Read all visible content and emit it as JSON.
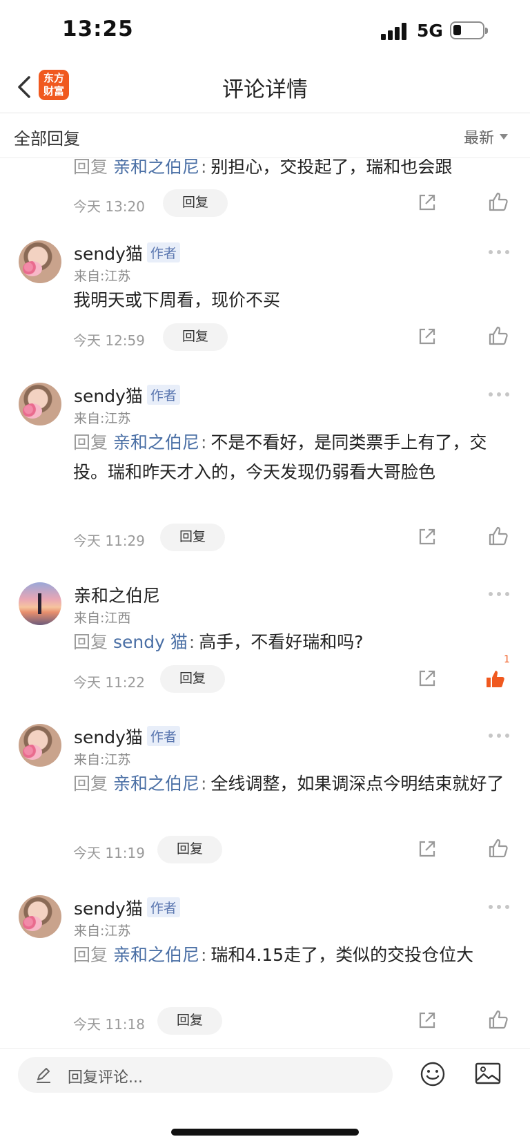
{
  "status": {
    "time": "13:25",
    "network": "5G"
  },
  "nav": {
    "title": "评论详情",
    "logo_line1": "东方",
    "logo_line2": "财富"
  },
  "section": {
    "all_label": "全部回复",
    "sort_label": "最新"
  },
  "common": {
    "reply_prefix": "回复",
    "reply_btn": "回复",
    "author_tag": "作者"
  },
  "comments": [
    {
      "text_reply_to": "亲和之伯尼",
      "text": "别担心，交投起了，瑞和也会跟",
      "time": "今天 13:20"
    },
    {
      "user": "sendy猫",
      "location": "来自:江苏",
      "text": "我明天或下周看，现价不买",
      "time": "今天 12:59"
    },
    {
      "user": "sendy猫",
      "location": "来自:江苏",
      "text_reply_to": "亲和之伯尼",
      "text": "不是不看好，是同类票手上有了，交投。瑞和昨天才入的，今天发现仍弱看大哥脸色",
      "time": "今天 11:29"
    },
    {
      "user": "亲和之伯尼",
      "location": "来自:江西",
      "text_reply_to": "sendy 猫",
      "text": "高手，不看好瑞和吗?",
      "time": "今天 11:22",
      "likes": "1"
    },
    {
      "user": "sendy猫",
      "location": "来自:江苏",
      "text_reply_to": "亲和之伯尼",
      "text": "全线调整，如果调深点今明结束就好了",
      "time": "今天 11:19"
    },
    {
      "user": "sendy猫",
      "location": "来自:江苏",
      "text_reply_to": "亲和之伯尼",
      "text": "瑞和4.15走了，类似的交投仓位大",
      "time": "今天 11:18"
    }
  ],
  "bottom": {
    "placeholder": "回复评论..."
  },
  "colors": {
    "accent": "#f0591f",
    "link": "#4a6fa5",
    "tag_bg": "#e8eef9"
  }
}
